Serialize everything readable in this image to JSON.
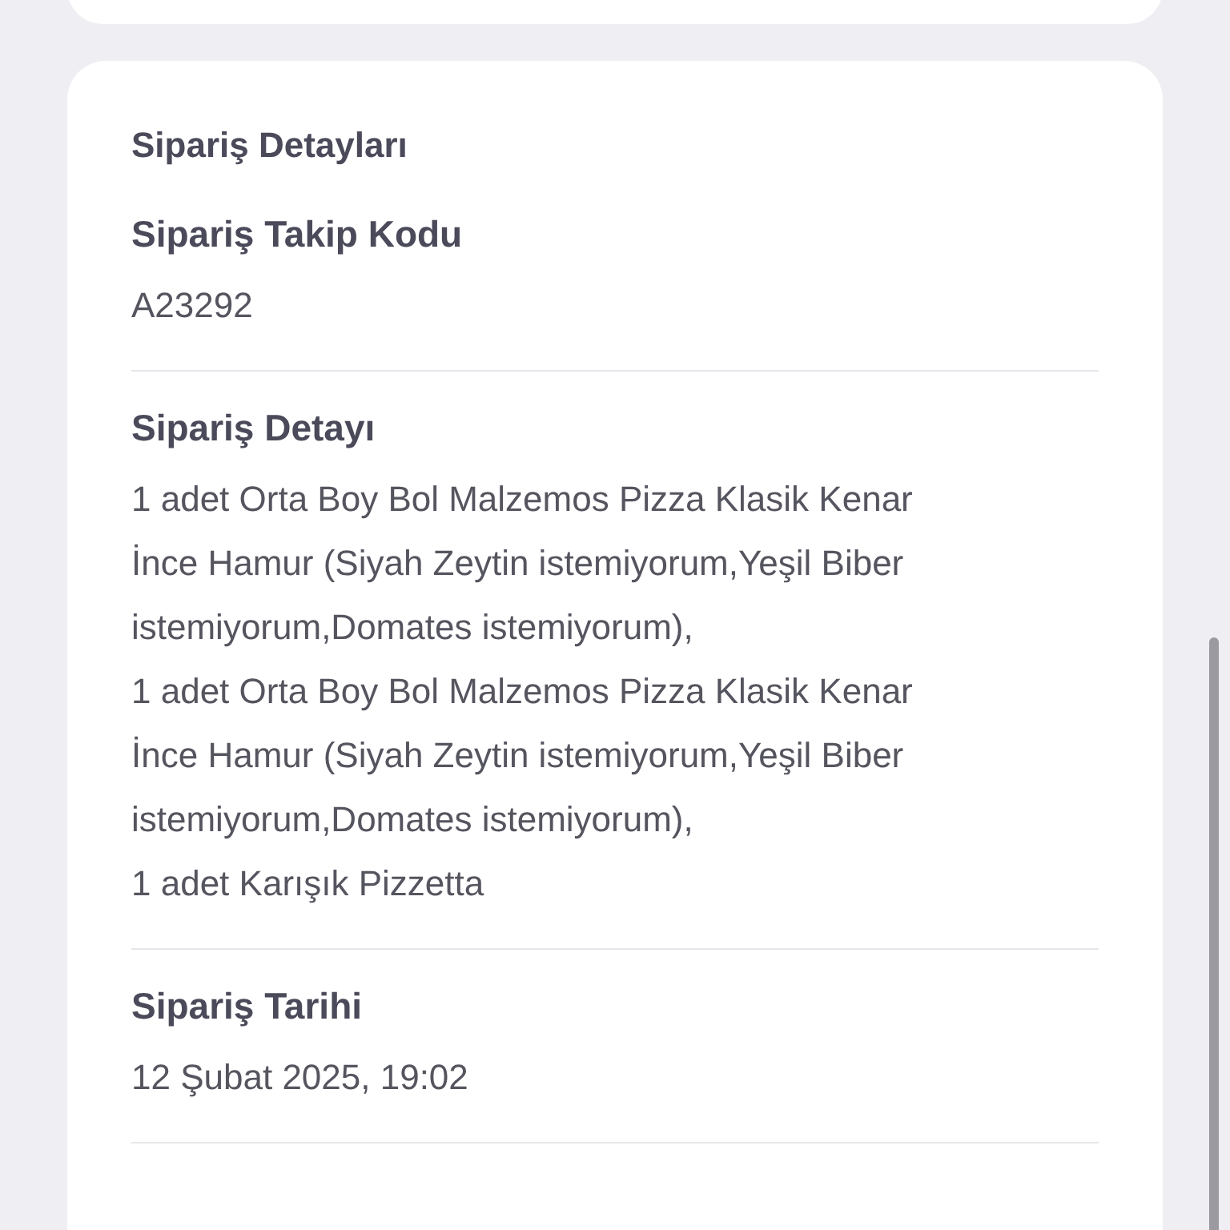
{
  "card": {
    "title": "Sipariş Detayları",
    "sections": [
      {
        "label": "Sipariş Takip Kodu",
        "lines": [
          "A23292"
        ]
      },
      {
        "label": "Sipariş Detayı",
        "lines": [
          "1 adet Orta Boy Bol Malzemos Pizza Klasik Kenar",
          "İnce Hamur (Siyah Zeytin istemiyorum,Yeşil Biber",
          "istemiyorum,Domates istemiyorum),",
          "1 adet Orta Boy Bol Malzemos Pizza Klasik Kenar",
          "İnce Hamur (Siyah Zeytin istemiyorum,Yeşil Biber",
          "istemiyorum,Domates istemiyorum),",
          "1 adet Karışık Pizzetta"
        ]
      },
      {
        "label": "Sipariş Tarihi",
        "lines": [
          "12 Şubat 2025, 19:02"
        ]
      }
    ]
  }
}
